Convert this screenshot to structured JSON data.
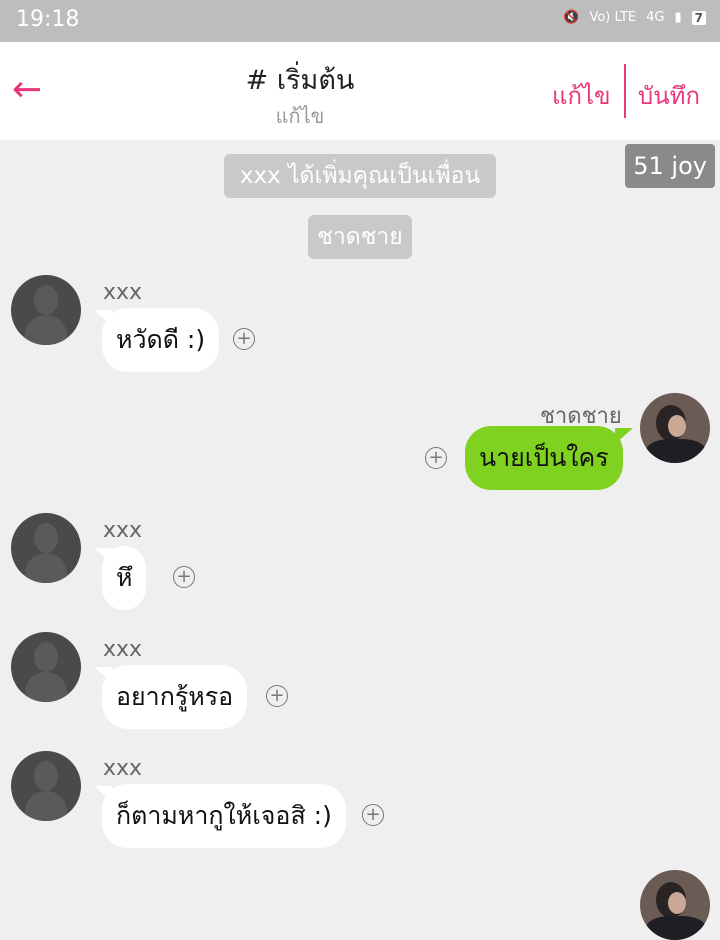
{
  "status": {
    "time": "19:18",
    "network": "Vo) LTE",
    "signal": "4G",
    "battery": "7"
  },
  "header": {
    "title": "# เริ่มต้น",
    "subtitle": "แก้ไข",
    "edit_label": "แก้ไข",
    "save_label": "บันทึก"
  },
  "system": {
    "added_msg": "xxx ได้เพิ่มคุณเป็นเพื่อน",
    "name_tag": "ชาดชาย",
    "corner_tag": "51 joy"
  },
  "me": {
    "name": "ชาดชาย"
  },
  "messages": [
    {
      "sender": "xxx",
      "text": "หวัดดี :)"
    },
    {
      "sender": "ชาดชาย",
      "text": "นายเป็นใคร"
    },
    {
      "sender": "xxx",
      "text": "หึ"
    },
    {
      "sender": "xxx",
      "text": "อยากรู้หรอ"
    },
    {
      "sender": "xxx",
      "text": "ก็ตามหากูให้เจอสิ :)"
    }
  ],
  "colors": {
    "accent": "#e8377a",
    "my_bubble": "#7fd320",
    "background": "#efefef"
  },
  "icons": {
    "back": "arrow-left-icon",
    "add_reaction": "plus-circle-icon",
    "mute": "mute-icon"
  }
}
